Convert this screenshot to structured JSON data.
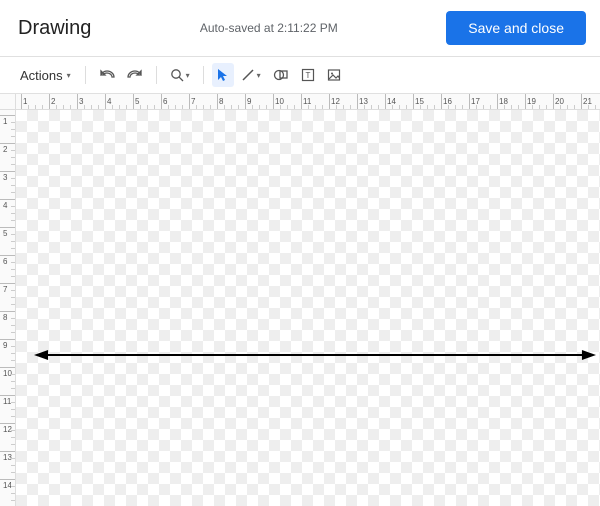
{
  "header": {
    "title": "Drawing",
    "status": "Auto-saved at 2:11:22 PM",
    "save_label": "Save and close"
  },
  "toolbar": {
    "actions_label": "Actions",
    "dropdown_glyph": "▾"
  },
  "ruler": {
    "h_labels": [
      "1",
      "2",
      "3",
      "4",
      "5",
      "6",
      "7",
      "8",
      "9",
      "10",
      "11",
      "12",
      "13",
      "14",
      "15",
      "16",
      "17",
      "18",
      "19",
      "20",
      "21"
    ],
    "v_labels": [
      "1",
      "2",
      "3",
      "4",
      "5",
      "6",
      "7",
      "8",
      "9",
      "10",
      "11",
      "12",
      "13",
      "14"
    ]
  },
  "canvas": {
    "shape": {
      "type": "double-arrow-line",
      "color": "#000000",
      "stroke_width": 2
    }
  }
}
